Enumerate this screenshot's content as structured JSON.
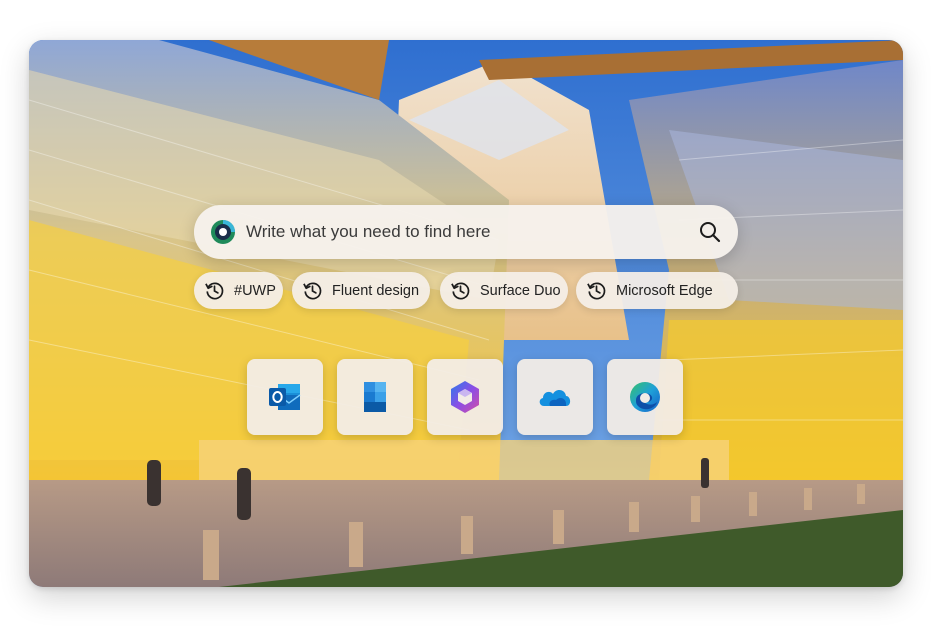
{
  "search": {
    "placeholder": "Write what you need to find here"
  },
  "recent_searches": [
    {
      "label": "#UWP"
    },
    {
      "label": "Fluent design"
    },
    {
      "label": "Surface Duo"
    },
    {
      "label": "Microsoft Edge"
    }
  ],
  "apps": [
    {
      "icon": "outlook-icon"
    },
    {
      "icon": "todo-icon"
    },
    {
      "icon": "microsoft-365-icon"
    },
    {
      "icon": "onedrive-icon"
    },
    {
      "icon": "edge-icon"
    }
  ],
  "colors": {
    "sky": "#3a7fd6",
    "glass_glow": "#f2c23a",
    "search_bg": "#f6f1ec",
    "grass": "#3f5a2a"
  }
}
